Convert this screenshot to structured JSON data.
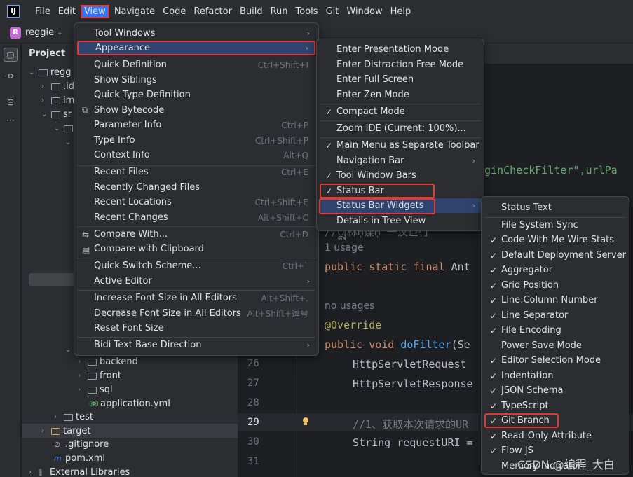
{
  "menubar": {
    "app_icon": "IJ",
    "items": [
      "File",
      "Edit",
      "View",
      "Navigate",
      "Code",
      "Refactor",
      "Build",
      "Run",
      "Tools",
      "Git",
      "Window",
      "Help"
    ]
  },
  "project": {
    "badge": "R",
    "name": "reggie"
  },
  "panel": {
    "title": "Project",
    "tree": [
      "regg",
      ".id",
      "im",
      "sr",
      "",
      "",
      "",
      "backend",
      "front",
      "sql",
      "application.yml",
      "test",
      "target",
      ".gitignore",
      "pom.xml",
      "External Libraries"
    ]
  },
  "editor": {
    "line_numbers": [
      "26",
      "27",
      "28",
      "29",
      "30",
      "31"
    ],
    "code": {
      "filter_str": "ginCheckFilter\",urlPa",
      "comment1": "//ᩎ林ᾟ谍ᾟ ⼀汶巨行",
      "usage": "1 usage",
      "const_line_kw": "public static final",
      "const_line_type": "Ant",
      "no_usages": "no usages",
      "override": "@Override",
      "method_kw": "public void",
      "method_name": "doFilter",
      "method_rest": "(Se",
      "req_type": "HttpServletRequest",
      "resp_type": "HttpServletResponse",
      "comment2": "//1、获取本次请求的UR",
      "string_line": "String requestURI ="
    }
  },
  "view_menu": {
    "items": [
      {
        "label": "Tool Windows",
        "shortcut": "",
        "arrow": true
      },
      {
        "label": "Appearance",
        "shortcut": "",
        "arrow": true
      },
      {
        "label": "Quick Definition",
        "shortcut": "Ctrl+Shift+I"
      },
      {
        "label": "Show Siblings",
        "shortcut": ""
      },
      {
        "label": "Quick Type Definition",
        "shortcut": ""
      },
      {
        "label": "Show Bytecode",
        "shortcut": ""
      },
      {
        "label": "Parameter Info",
        "shortcut": "Ctrl+P"
      },
      {
        "label": "Type Info",
        "shortcut": "Ctrl+Shift+P"
      },
      {
        "label": "Context Info",
        "shortcut": "Alt+Q"
      },
      {
        "label": "Recent Files",
        "shortcut": "Ctrl+E"
      },
      {
        "label": "Recently Changed Files",
        "shortcut": ""
      },
      {
        "label": "Recent Locations",
        "shortcut": "Ctrl+Shift+E"
      },
      {
        "label": "Recent Changes",
        "shortcut": "Alt+Shift+C"
      },
      {
        "label": "Compare With...",
        "shortcut": "Ctrl+D"
      },
      {
        "label": "Compare with Clipboard",
        "shortcut": ""
      },
      {
        "label": "Quick Switch Scheme...",
        "shortcut": "Ctrl+`"
      },
      {
        "label": "Active Editor",
        "shortcut": "",
        "arrow": true
      },
      {
        "label": "Increase Font Size in All Editors",
        "shortcut": "Alt+Shift+."
      },
      {
        "label": "Decrease Font Size in All Editors",
        "shortcut": "Alt+Shift+逗号"
      },
      {
        "label": "Reset Font Size",
        "shortcut": ""
      },
      {
        "label": "Bidi Text Base Direction",
        "shortcut": "",
        "arrow": true
      }
    ]
  },
  "appearance_menu": {
    "items": [
      {
        "label": "Enter Presentation Mode"
      },
      {
        "label": "Enter Distraction Free Mode"
      },
      {
        "label": "Enter Full Screen"
      },
      {
        "label": "Enter Zen Mode"
      },
      {
        "label": "Compact Mode",
        "checked": true
      },
      {
        "label": "Zoom IDE (Current: 100%)..."
      },
      {
        "label": "Main Menu as Separate Toolbar",
        "checked": true
      },
      {
        "label": "Navigation Bar",
        "arrow": true
      },
      {
        "label": "Tool Window Bars",
        "checked": true
      },
      {
        "label": "Status Bar",
        "checked": true
      },
      {
        "label": "Status Bar Widgets",
        "arrow": true
      },
      {
        "label": "Details in Tree View"
      }
    ]
  },
  "widgets_menu": {
    "items": [
      {
        "label": "Status Text",
        "checked": false
      },
      {
        "label": "File System Sync",
        "checked": false
      },
      {
        "label": "Code With Me Wire Stats",
        "checked": true
      },
      {
        "label": "Default Deployment Server",
        "checked": true
      },
      {
        "label": "Aggregator",
        "checked": true
      },
      {
        "label": "Grid Position",
        "checked": true
      },
      {
        "label": "Line:Column Number",
        "checked": true
      },
      {
        "label": "Line Separator",
        "checked": true
      },
      {
        "label": "File Encoding",
        "checked": true
      },
      {
        "label": "Power Save Mode",
        "checked": false
      },
      {
        "label": "Editor Selection Mode",
        "checked": true
      },
      {
        "label": "Indentation",
        "checked": true
      },
      {
        "label": "JSON Schema",
        "checked": true
      },
      {
        "label": "TypeScript",
        "checked": true
      },
      {
        "label": "Git Branch",
        "checked": true
      },
      {
        "label": "Read-Only Attribute",
        "checked": true
      },
      {
        "label": "Flow JS",
        "checked": true
      },
      {
        "label": "Memory Indicator",
        "checked": false
      }
    ]
  },
  "watermark": "CSDN @编程_大白",
  "colors": {
    "accent": "#3574f0",
    "highlight_border": "#e53935",
    "selection": "#2e436e"
  }
}
